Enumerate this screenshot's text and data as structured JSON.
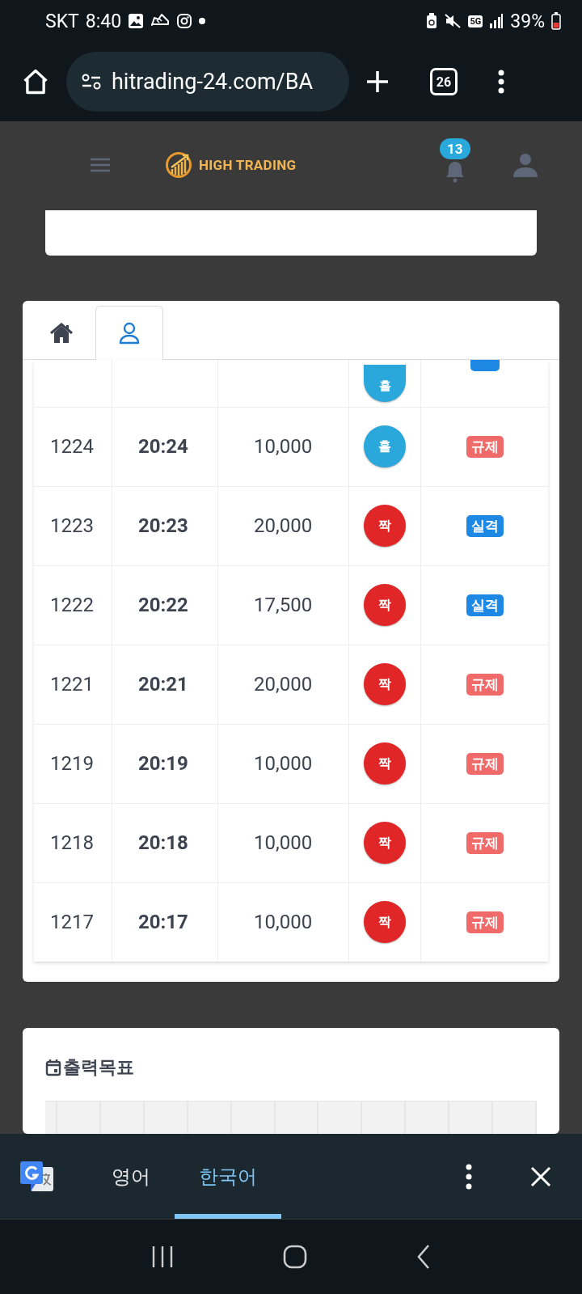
{
  "status_bar": {
    "carrier": "SKT",
    "time": "8:40",
    "network": "5G",
    "battery": "39%"
  },
  "browser": {
    "url": "hitrading-24.com/BA",
    "tab_count": "26"
  },
  "header": {
    "brand": "HIGH TRADING",
    "notification_count": "13"
  },
  "tabs": [
    {
      "selected": false
    },
    {
      "selected": true
    }
  ],
  "rows": [
    {
      "result": {
        "kind": "odd",
        "label": "홀"
      },
      "status": {
        "kind": "disqualified"
      }
    },
    {
      "round": "1224",
      "time": "20:24",
      "amount": "10,000",
      "result": {
        "kind": "odd",
        "label": "홀"
      },
      "status": {
        "kind": "restricted",
        "label": "규제"
      }
    },
    {
      "round": "1223",
      "time": "20:23",
      "amount": "20,000",
      "result": {
        "kind": "even",
        "label": "짝"
      },
      "status": {
        "kind": "disqualified",
        "label": "실격"
      }
    },
    {
      "round": "1222",
      "time": "20:22",
      "amount": "17,500",
      "result": {
        "kind": "even",
        "label": "짝"
      },
      "status": {
        "kind": "disqualified",
        "label": "실격"
      }
    },
    {
      "round": "1221",
      "time": "20:21",
      "amount": "20,000",
      "result": {
        "kind": "even",
        "label": "짝"
      },
      "status": {
        "kind": "restricted",
        "label": "규제"
      }
    },
    {
      "round": "1219",
      "time": "20:19",
      "amount": "10,000",
      "result": {
        "kind": "even",
        "label": "짝"
      },
      "status": {
        "kind": "restricted",
        "label": "규제"
      }
    },
    {
      "round": "1218",
      "time": "20:18",
      "amount": "10,000",
      "result": {
        "kind": "even",
        "label": "짝"
      },
      "status": {
        "kind": "restricted",
        "label": "규제"
      }
    },
    {
      "round": "1217",
      "time": "20:17",
      "amount": "10,000",
      "result": {
        "kind": "even",
        "label": "짝"
      },
      "status": {
        "kind": "restricted",
        "label": "규제"
      }
    }
  ],
  "targets": {
    "title": "출력목표"
  },
  "translate_bar": {
    "languages": [
      {
        "label": "영어",
        "selected": false
      },
      {
        "label": "한국어",
        "selected": true
      }
    ]
  }
}
